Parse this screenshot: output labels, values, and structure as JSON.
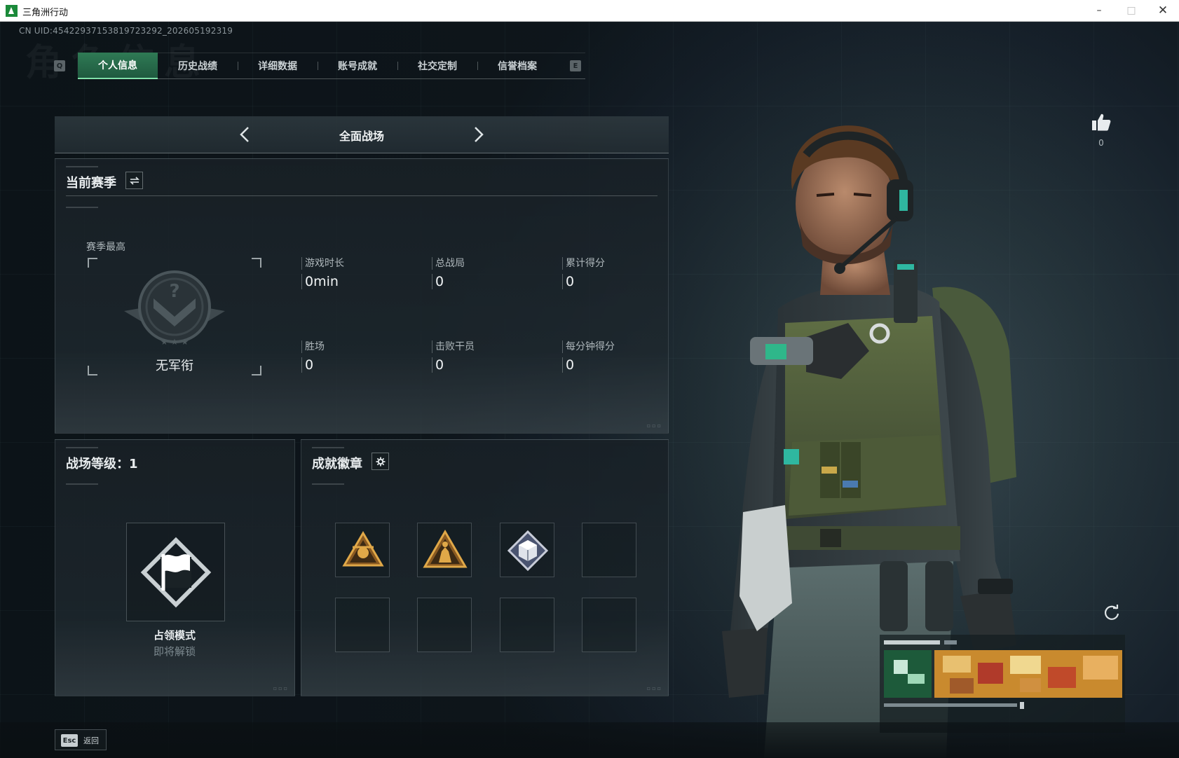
{
  "window": {
    "title": "三角洲行动",
    "controls": {
      "minimize": "–",
      "maximize": "□",
      "close": "✕"
    }
  },
  "header": {
    "uid": "CN UID:45422937153819723292_202605192319",
    "watermark": "角色信息"
  },
  "tabs": {
    "left_key": "Q",
    "right_key": "E",
    "items": [
      {
        "label": "个人信息",
        "active": true
      },
      {
        "label": "历史战绩",
        "active": false
      },
      {
        "label": "详细数据",
        "active": false
      },
      {
        "label": "账号成就",
        "active": false
      },
      {
        "label": "社交定制",
        "active": false
      },
      {
        "label": "信誉档案",
        "active": false
      }
    ]
  },
  "mode_selector": {
    "label": "全面战场",
    "prev_icon": "chevron-left-icon",
    "next_icon": "chevron-right-icon"
  },
  "season": {
    "title": "当前赛季",
    "switch_icon": "swap-icon",
    "best_label": "赛季最高",
    "rank_name": "无军衔",
    "stats": [
      {
        "label": "游戏时长",
        "value": "0min"
      },
      {
        "label": "总战局",
        "value": "0"
      },
      {
        "label": "累计得分",
        "value": "0"
      },
      {
        "label": "胜场",
        "value": "0"
      },
      {
        "label": "击败干员",
        "value": "0"
      },
      {
        "label": "每分钟得分",
        "value": "0"
      }
    ]
  },
  "battlefield_level": {
    "title": "战场等级：1",
    "mode_card": {
      "name": "占领模式",
      "status": "即将解锁",
      "icon": "flag-icon"
    }
  },
  "achievements": {
    "title": "成就徽章",
    "settings_icon": "gear-icon",
    "slots": [
      {
        "icon": "gold-triangle-emblem-icon",
        "filled": true
      },
      {
        "icon": "gold-triangle-soldier-icon",
        "filled": true
      },
      {
        "icon": "silver-diamond-cube-icon",
        "filled": true
      },
      {
        "icon": "",
        "filled": false
      },
      {
        "icon": "",
        "filled": false
      },
      {
        "icon": "",
        "filled": false
      },
      {
        "icon": "",
        "filled": false
      },
      {
        "icon": "",
        "filled": false
      }
    ]
  },
  "character": {
    "likes": "0",
    "like_icon": "thumbs-up-icon",
    "refresh_icon": "refresh-icon"
  },
  "footer": {
    "esc_key": "Esc",
    "back_label": "返回"
  },
  "colors": {
    "accent_green": "#2f7a55",
    "accent_green_light": "#7fe0a8",
    "background": "#16202a",
    "badge_gold": "#c98a2e"
  }
}
